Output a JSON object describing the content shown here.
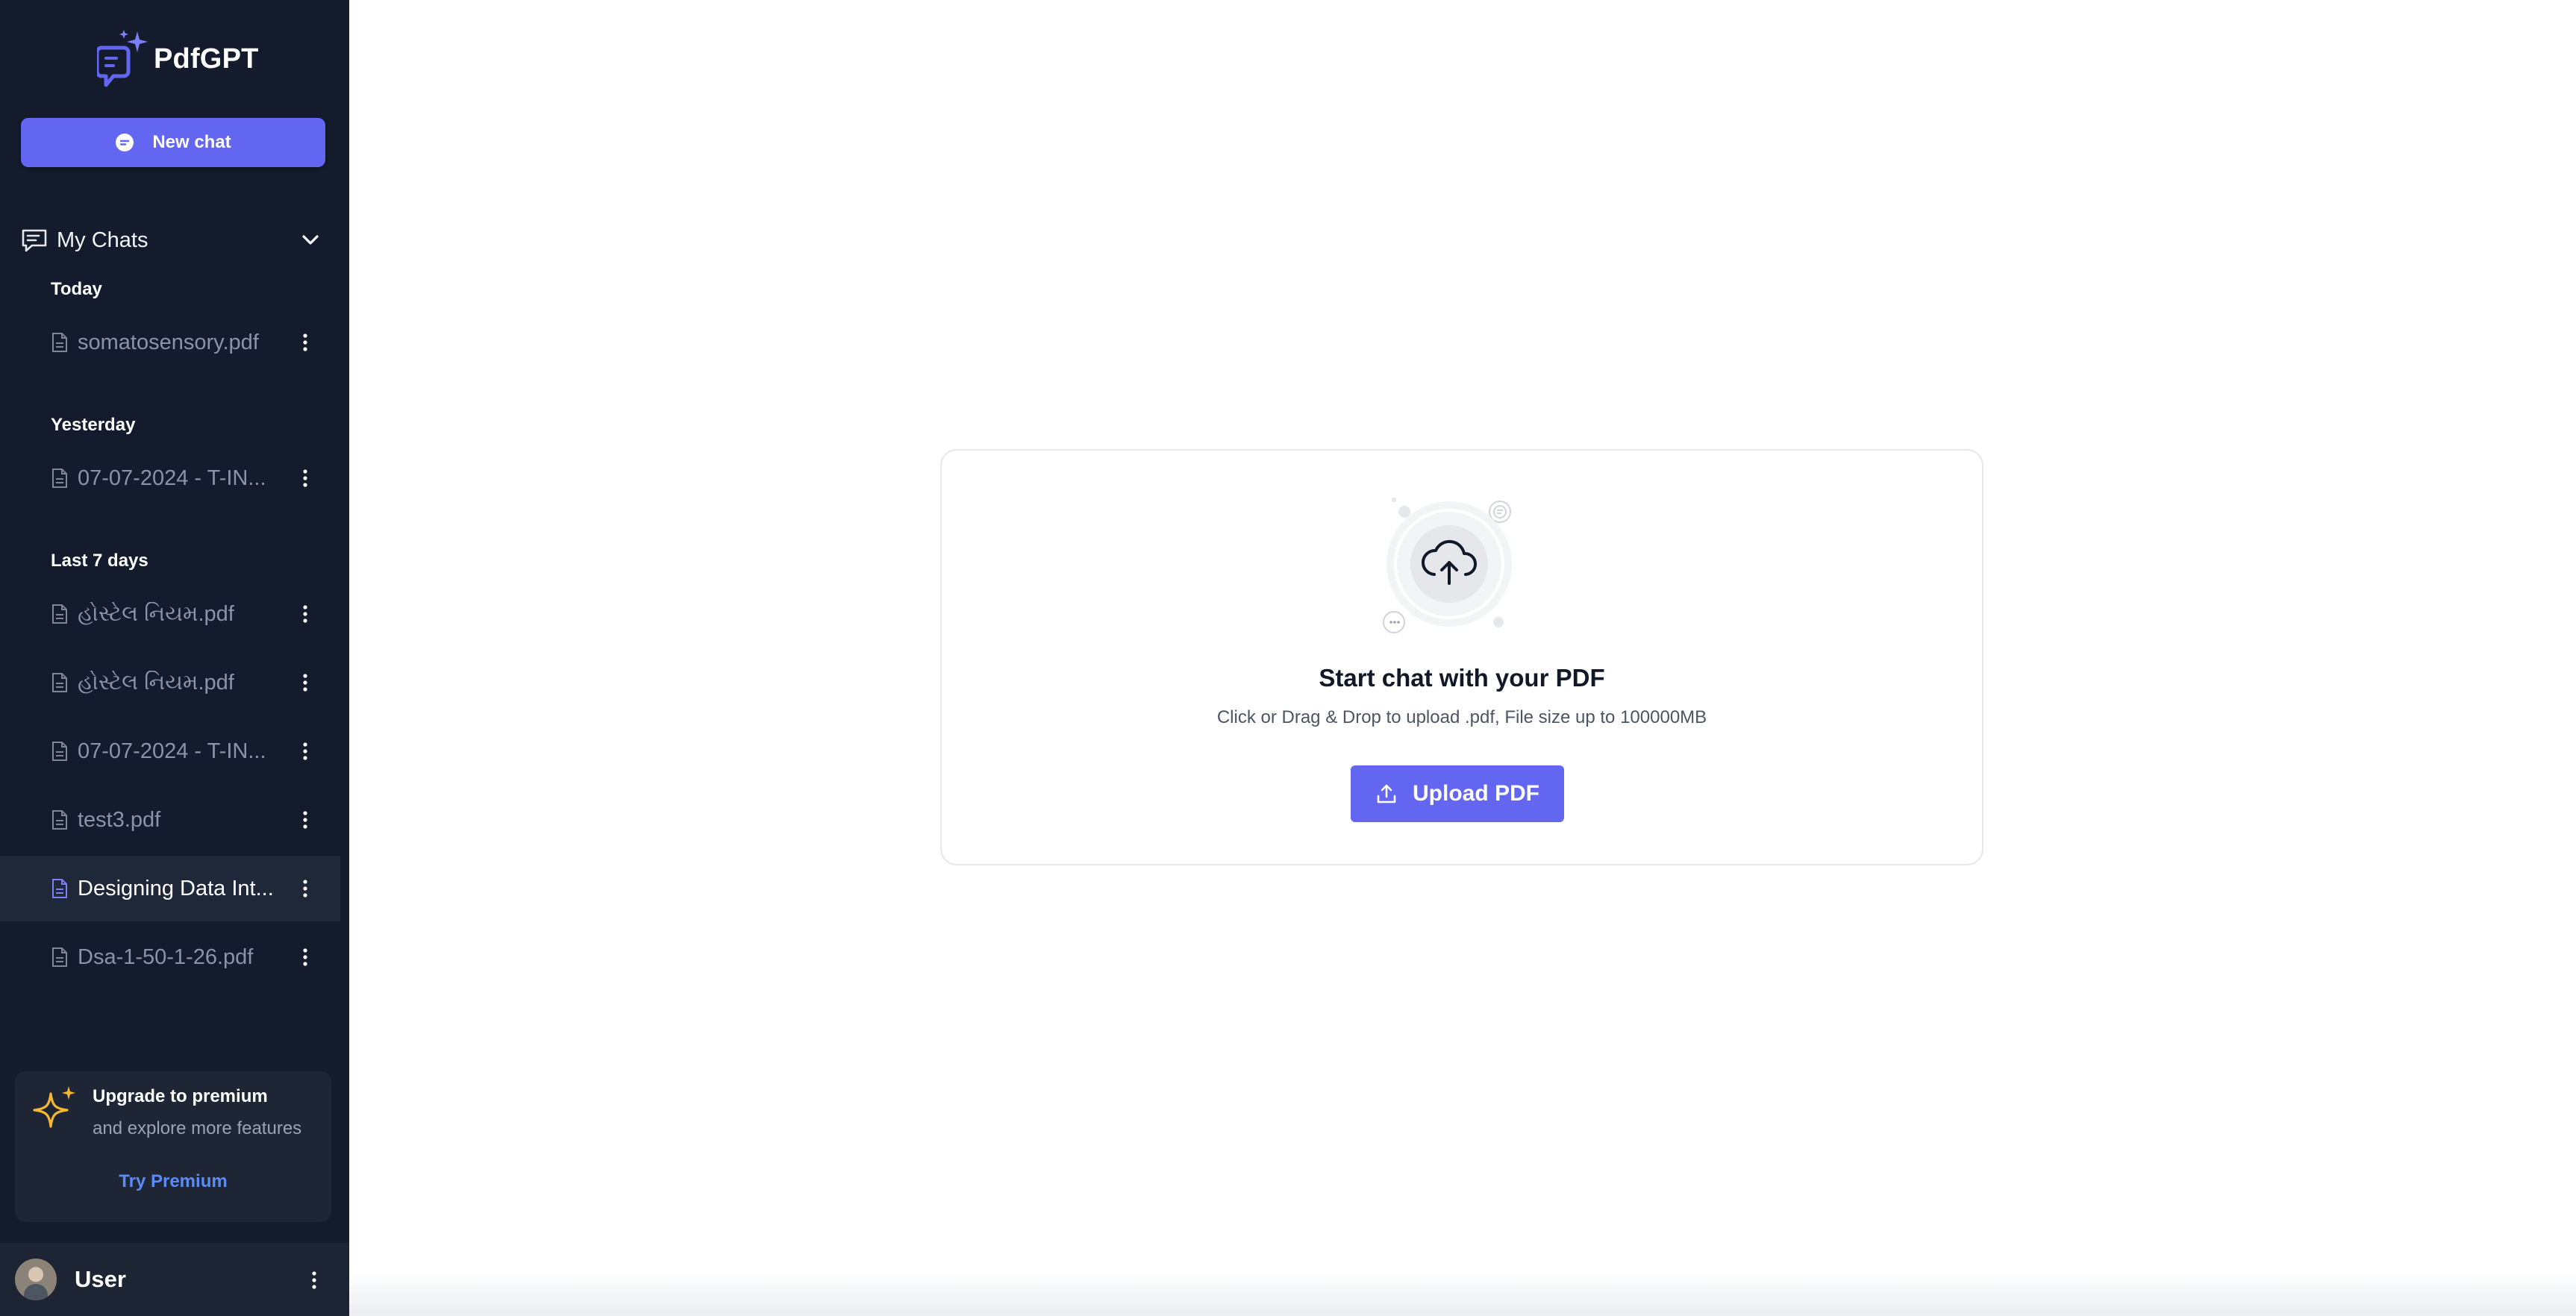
{
  "app": {
    "name": "PdfGPT"
  },
  "sidebar": {
    "new_chat_label": "New chat",
    "my_chats_label": "My Chats",
    "groups": [
      {
        "label": "Today"
      },
      {
        "label": "Yesterday"
      },
      {
        "label": "Last 7 days"
      }
    ],
    "chats": [
      {
        "name": "somatosensory.pdf",
        "group": "Today",
        "active": false
      },
      {
        "name": "07-07-2024 - T-IN...",
        "group": "Yesterday",
        "active": false
      },
      {
        "name": "હોસ્ટેલ નિયમ.pdf",
        "group": "Last 7 days",
        "active": false
      },
      {
        "name": "હોસ્ટેલ નિયમ.pdf",
        "group": "Last 7 days",
        "active": false
      },
      {
        "name": "07-07-2024 - T-IN...",
        "group": "Last 7 days",
        "active": false
      },
      {
        "name": "test3.pdf",
        "group": "Last 7 days",
        "active": false
      },
      {
        "name": "Designing Data Int...",
        "group": "Last 7 days",
        "active": true
      },
      {
        "name": "Dsa-1-50-1-26.pdf",
        "group": "Last 7 days",
        "active": false
      }
    ],
    "upgrade": {
      "title": "Upgrade to premium",
      "subtitle": "and explore more features",
      "cta": "Try Premium"
    },
    "user": {
      "name": "User"
    }
  },
  "main": {
    "upload": {
      "title": "Start chat with your PDF",
      "subtitle": "Click or Drag & Drop to upload .pdf, File size up to 100000MB",
      "button_label": "Upload PDF"
    }
  },
  "icons": {
    "logo": "chat-document-sparkle-icon",
    "new_chat": "chat-bubble-icon",
    "my_chats": "message-square-icon",
    "chevron": "chevron-down-icon",
    "file": "file-text-icon",
    "more": "more-vertical-icon",
    "sparkle": "sparkle-icon",
    "upload_cloud": "cloud-upload-icon",
    "upload": "upload-icon"
  },
  "colors": {
    "sidebar_bg": "#131b2c",
    "accent": "#6366f1",
    "active_item_bg": "#1f2838",
    "premium_link": "#5b8cf5",
    "sparkle": "#f5b82e"
  }
}
